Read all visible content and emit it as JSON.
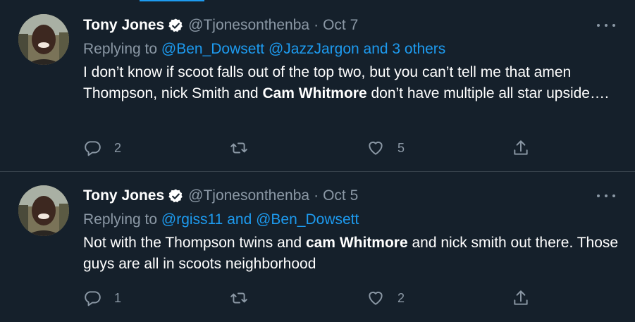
{
  "colors": {
    "background": "#15202b",
    "accent": "#1d9bf0",
    "muted": "#8b98a5",
    "divider": "#38444d"
  },
  "tweets": [
    {
      "author_name": "Tony Jones",
      "handle": "@Tjonesonthenba",
      "separator": "·",
      "date": "Oct 7",
      "reply_prefix": "Replying to",
      "reply_links": [
        "@Ben_Dowsett",
        "@JazzJargon",
        "and 3 others"
      ],
      "body": [
        {
          "text": "I don’t know if scoot falls out of the top two, but you can’t tell me that amen Thompson, nick Smith and ",
          "bold": false
        },
        {
          "text": "Cam Whitmore",
          "bold": true
        },
        {
          "text": " don’t have multiple all star upside….",
          "bold": false
        }
      ],
      "reply_count": "2",
      "retweet_count": "",
      "like_count": "5"
    },
    {
      "author_name": "Tony Jones",
      "handle": "@Tjonesonthenba",
      "separator": "·",
      "date": "Oct 5",
      "reply_prefix": "Replying to",
      "reply_links": [
        "@rgiss11",
        "and",
        "@Ben_Dowsett"
      ],
      "body": [
        {
          "text": "Not with the Thompson twins and ",
          "bold": false
        },
        {
          "text": "cam Whitmore",
          "bold": true
        },
        {
          "text": " and nick smith out there. Those guys are all in scoots neighborhood",
          "bold": false
        }
      ],
      "reply_count": "1",
      "retweet_count": "",
      "like_count": "2"
    }
  ],
  "icons": [
    "verified-badge-icon",
    "more-options-icon",
    "reply-icon",
    "retweet-icon",
    "like-icon",
    "share-icon"
  ]
}
